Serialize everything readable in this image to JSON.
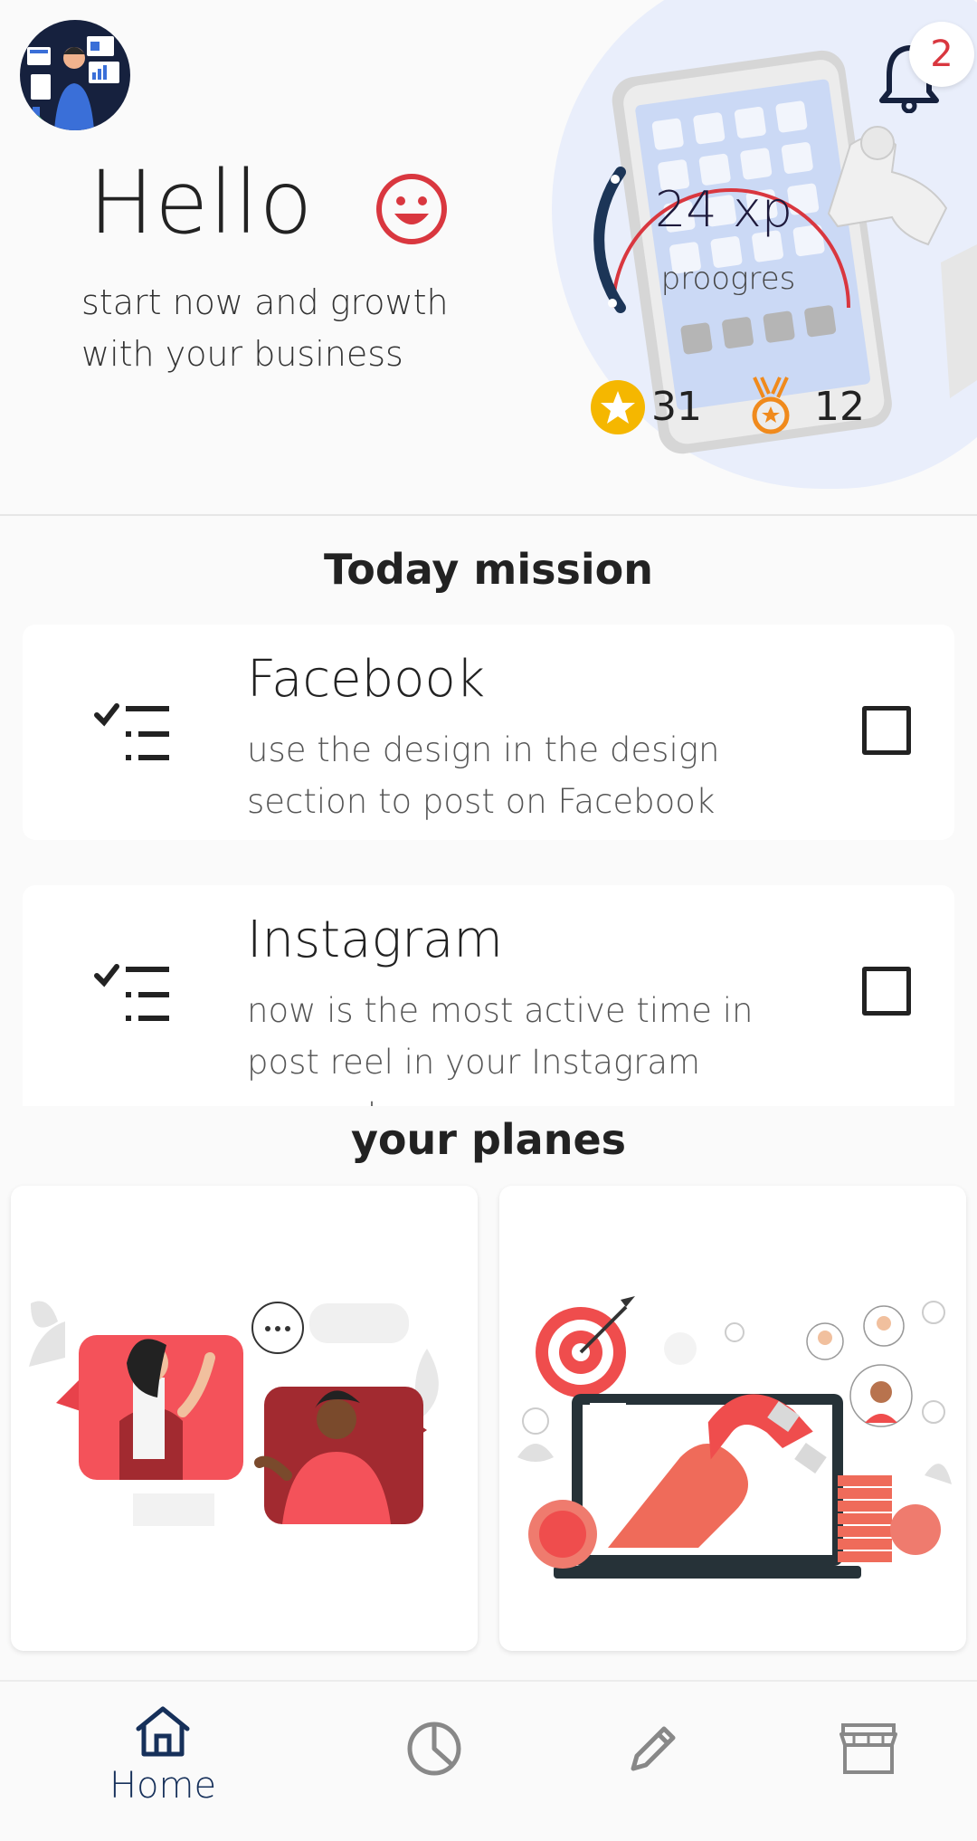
{
  "header": {
    "greeting": "Hello",
    "subtitle": "start now and growth with your business",
    "notifications_count": "2",
    "xp_value": "24 xp",
    "progress_label": "proogres",
    "stars_count": "31",
    "medals_count": "12"
  },
  "missions": {
    "title": "Today mission",
    "items": [
      {
        "title": "Facebook",
        "description": "use the design in the design section to post on Facebook"
      },
      {
        "title": "Instagram",
        "description": "now is the most active time in post reel in your Instagram account"
      }
    ]
  },
  "planes": {
    "title": "your planes"
  },
  "nav": {
    "items": [
      {
        "label": "Home",
        "icon": "home-icon"
      },
      {
        "label": "",
        "icon": "pie-chart-icon"
      },
      {
        "label": "",
        "icon": "pencil-icon"
      },
      {
        "label": "",
        "icon": "store-icon"
      }
    ]
  },
  "colors": {
    "accent": "#d9373f",
    "navy": "#16305a",
    "gold": "#f5b700",
    "orange": "#f08a1c"
  }
}
